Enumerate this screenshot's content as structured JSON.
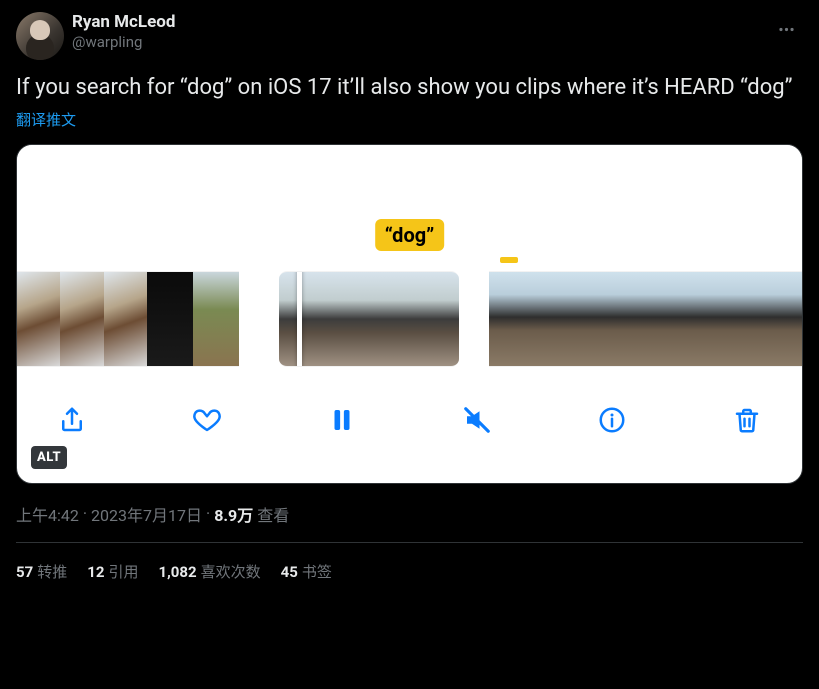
{
  "author": {
    "display_name": "Ryan McLeod",
    "handle": "@warpling"
  },
  "body": "If you search for “dog” on iOS 17 it’ll also show you clips where it’s HEARD “dog”",
  "translate_label": "翻译推文",
  "media": {
    "tooltip": "“dog”",
    "alt_badge": "ALT",
    "toolbar": {
      "share": "share",
      "like": "like",
      "pause": "pause",
      "mute": "mute",
      "info": "info",
      "trash": "trash"
    }
  },
  "meta": {
    "time": "上午4:42",
    "sep": " · ",
    "date": "2023年7月17日",
    "views_count": "8.9万",
    "views_label": " 查看"
  },
  "stats": {
    "retweets_n": "57",
    "retweets_label": "转推",
    "quotes_n": "12",
    "quotes_label": "引用",
    "likes_n": "1,082",
    "likes_label": "喜欢次数",
    "bookmarks_n": "45",
    "bookmarks_label": "书签"
  }
}
